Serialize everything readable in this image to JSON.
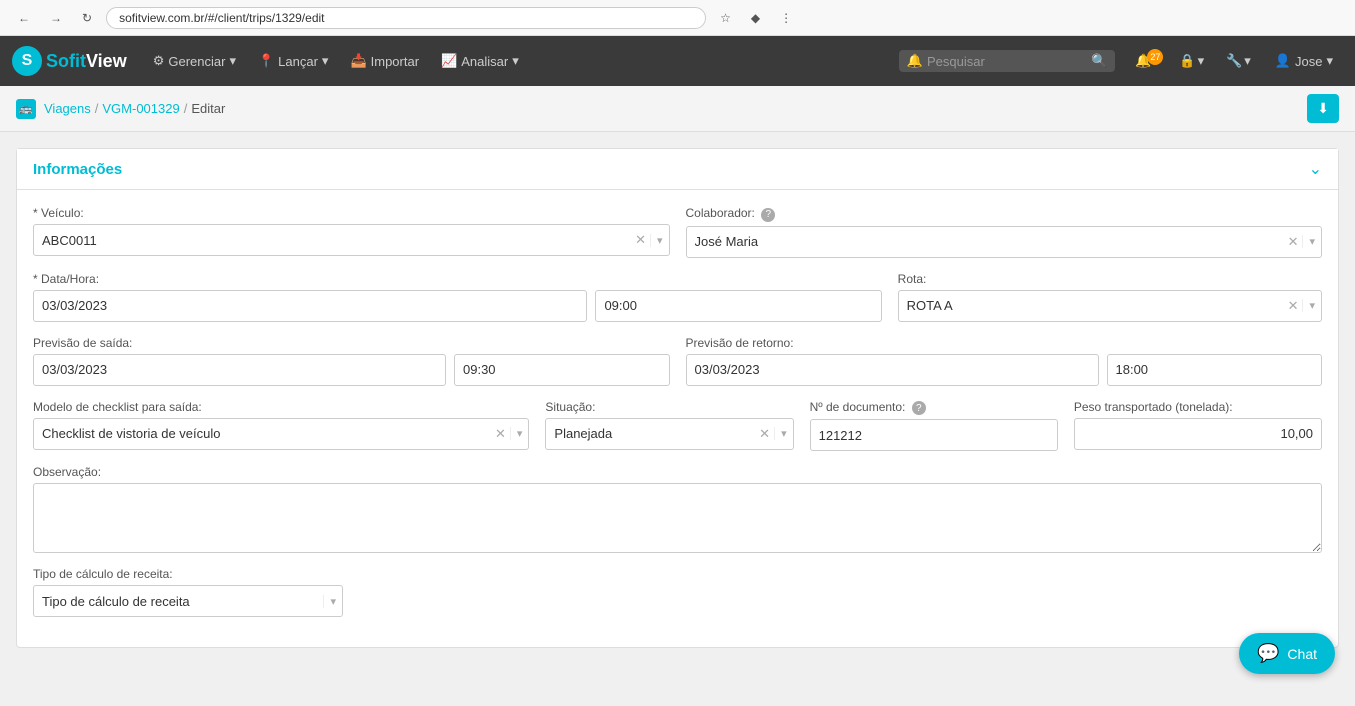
{
  "browser": {
    "url": "sofitview.com.br/#/client/trips/1329/edit",
    "back_title": "Back",
    "forward_title": "Forward",
    "refresh_title": "Refresh"
  },
  "navbar": {
    "brand_name_sofit": "Sofit",
    "brand_name_view": "View",
    "menu_items": [
      {
        "id": "gerenciar",
        "label": "Gerenciar",
        "has_dropdown": true,
        "icon": "⚙"
      },
      {
        "id": "lancar",
        "label": "Lançar",
        "has_dropdown": true,
        "icon": "📍"
      },
      {
        "id": "importar",
        "label": "Importar",
        "has_dropdown": false,
        "icon": "📥"
      },
      {
        "id": "analisar",
        "label": "Analisar",
        "has_dropdown": true,
        "icon": "📈"
      }
    ],
    "search_placeholder": "Pesquisar",
    "notification_count": "27",
    "user_name": "Jose"
  },
  "breadcrumb": {
    "icon": "🚌",
    "trips_label": "Viagens",
    "trip_id_label": "VGM-001329",
    "current_label": "Editar"
  },
  "form": {
    "section_title": "Informações",
    "fields": {
      "veiculo_label": "* Veículo:",
      "veiculo_value": "ABC0011",
      "colaborador_label": "Colaborador:",
      "colaborador_value": "José Maria",
      "data_hora_label": "* Data/Hora:",
      "data_value": "03/03/2023",
      "hora_value": "09:00",
      "rota_label": "Rota:",
      "rota_value": "ROTA A",
      "previsao_saida_label": "Previsão de saída:",
      "previsao_saida_date": "03/03/2023",
      "previsao_saida_time": "09:30",
      "previsao_retorno_label": "Previsão de retorno:",
      "previsao_retorno_date": "03/03/2023",
      "previsao_retorno_time": "18:00",
      "checklist_label": "Modelo de checklist para saída:",
      "checklist_value": "Checklist de vistoria de veículo",
      "situacao_label": "Situação:",
      "situacao_value": "Planejada",
      "doc_label": "Nº de documento:",
      "doc_value": "121212",
      "peso_label": "Peso transportado (tonelada):",
      "peso_value": "10,00",
      "observacao_label": "Observação:",
      "tipo_calculo_label": "Tipo de cálculo de receita:",
      "tipo_calculo_placeholder": "Tipo de cálculo de receita"
    }
  },
  "chat_button": {
    "label": "Chat"
  }
}
